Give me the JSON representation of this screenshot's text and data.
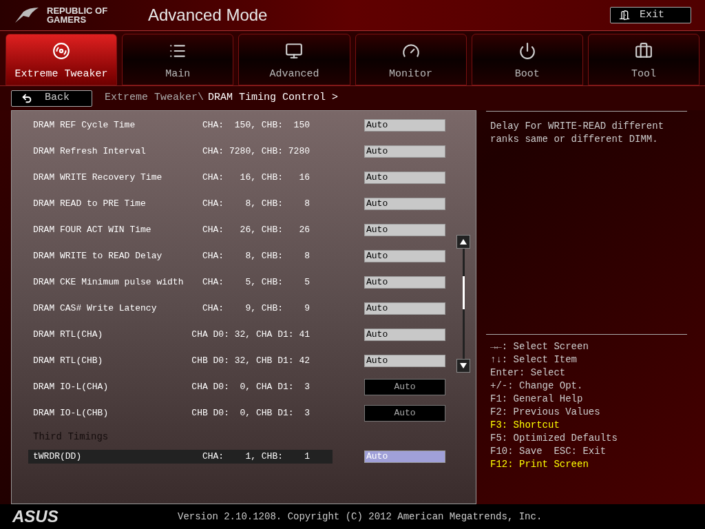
{
  "header": {
    "logo_line_1": "REPUBLIC OF",
    "logo_line_2": "GAMERS",
    "title": "Advanced Mode",
    "exit_button": "Exit"
  },
  "tabs": [
    {
      "label": "Extreme Tweaker",
      "selected": true
    },
    {
      "label": "Main",
      "selected": false
    },
    {
      "label": "Advanced",
      "selected": false
    },
    {
      "label": "Monitor",
      "selected": false
    },
    {
      "label": "Boot",
      "selected": false
    },
    {
      "label": "Tool",
      "selected": false
    }
  ],
  "breadcrumb": {
    "back_button": "Back",
    "parent": "Extreme Tweaker\\",
    "current": "DRAM Timing Control >"
  },
  "settings": [
    {
      "kind": "field",
      "name": "DRAM REF Cycle Time",
      "reading": "CHA:  150, CHB:  150",
      "value": "Auto",
      "selected": false
    },
    {
      "kind": "field",
      "name": "DRAM Refresh Interval",
      "reading": "CHA: 7280, CHB: 7280",
      "value": "Auto",
      "selected": false
    },
    {
      "kind": "field",
      "name": "DRAM WRITE Recovery Time",
      "reading": "CHA:   16, CHB:   16",
      "value": "Auto",
      "selected": false
    },
    {
      "kind": "field",
      "name": "DRAM READ to PRE Time",
      "reading": "CHA:    8, CHB:    8",
      "value": "Auto",
      "selected": false
    },
    {
      "kind": "field",
      "name": "DRAM FOUR ACT WIN Time",
      "reading": "CHA:   26, CHB:   26",
      "value": "Auto",
      "selected": false
    },
    {
      "kind": "field",
      "name": "DRAM WRITE to READ Delay",
      "reading": "CHA:    8, CHB:    8",
      "value": "Auto",
      "selected": false
    },
    {
      "kind": "field",
      "name": "DRAM CKE Minimum pulse width",
      "reading": "CHA:    5, CHB:    5",
      "value": "Auto",
      "selected": false
    },
    {
      "kind": "field",
      "name": "DRAM CAS# Write Latency",
      "reading": "CHA:    9, CHB:    9",
      "value": "Auto",
      "selected": false
    },
    {
      "kind": "field",
      "name": "DRAM RTL(CHA)",
      "reading": "CHA D0: 32, CHA D1: 41",
      "value": "Auto",
      "selected": false
    },
    {
      "kind": "field",
      "name": "DRAM RTL(CHB)",
      "reading": "CHB D0: 32, CHB D1: 42",
      "value": "Auto",
      "selected": false
    },
    {
      "kind": "dropdown",
      "name": "DRAM IO-L(CHA)",
      "reading": "CHA D0:  0, CHA D1:  3",
      "value": "Auto",
      "selected": false
    },
    {
      "kind": "dropdown",
      "name": "DRAM IO-L(CHB)",
      "reading": "CHB D0:  0, CHB D1:  3",
      "value": "Auto",
      "selected": false
    },
    {
      "kind": "section",
      "label": "Third Timings"
    },
    {
      "kind": "field",
      "name": "tWRDR(DD)",
      "reading": "CHA:    1, CHB:    1",
      "value": "Auto",
      "selected": true
    }
  ],
  "help": {
    "description": "Delay For WRITE-READ different ranks same or different DIMM.",
    "keys": [
      {
        "text": "→←: Select Screen",
        "highlighted": false
      },
      {
        "text": "↑↓: Select Item",
        "highlighted": false
      },
      {
        "text": "Enter: Select",
        "highlighted": false
      },
      {
        "text": "+/-: Change Opt.",
        "highlighted": false
      },
      {
        "text": "F1: General Help",
        "highlighted": false
      },
      {
        "text": "F2: Previous Values",
        "highlighted": false
      },
      {
        "text": "F3: Shortcut",
        "highlighted": true
      },
      {
        "text": "F5: Optimized Defaults",
        "highlighted": false
      },
      {
        "text": "F10: Save  ESC: Exit",
        "highlighted": false
      },
      {
        "text": "F12: Print Screen",
        "highlighted": true
      }
    ]
  },
  "footer": {
    "brand": "ASUS",
    "version": "Version 2.10.1208. Copyright (C) 2012 American Megatrends, Inc."
  }
}
